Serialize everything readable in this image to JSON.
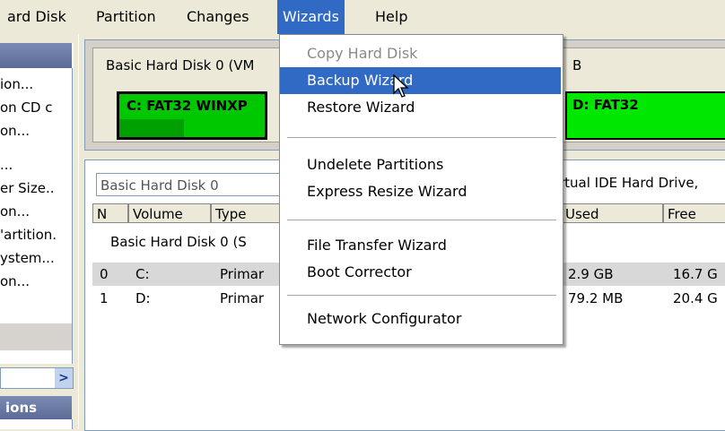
{
  "menubar": {
    "items": [
      "ard Disk",
      "Partition",
      "Changes",
      "Wizards",
      "Help"
    ],
    "active": "Wizards"
  },
  "left_pane": {
    "items": [
      "ion...",
      "on CD c",
      "on...",
      "...",
      "er Size..",
      "on...",
      "'artition.",
      "ystem...",
      "on..."
    ],
    "section": "ions",
    "scroll_arrow": ">"
  },
  "disk_map": {
    "label": "Basic Hard Disk 0 (VM",
    "label_b": "B",
    "partition_c": "C: FAT32 WINXP",
    "partition_d": "D: FAT32"
  },
  "table": {
    "title": "Basic Hard Disk 0",
    "title_right": "rtual IDE Hard Drive,",
    "columns": [
      "N",
      "Volume",
      "Type",
      "Used",
      "Free"
    ],
    "group": "Basic Hard Disk 0 (S",
    "rows": [
      {
        "n": "0",
        "volume": "C:",
        "type": "Primar",
        "used": "2.9 GB",
        "free": "16.7 G"
      },
      {
        "n": "1",
        "volume": "D:",
        "type": "Primar",
        "used": "79.2 MB",
        "free": "20.4 G"
      }
    ]
  },
  "wizards_menu": {
    "copy_hard_disk": "Copy Hard Disk",
    "backup_wizard": "Backup Wizard",
    "restore_wizard": "Restore Wizard",
    "undelete_partitions": "Undelete Partitions",
    "express_resize_wizard": "Express Resize Wizard",
    "file_transfer_wizard": "File Transfer Wizard",
    "boot_corrector": "Boot Corrector",
    "network_configurator": "Network Configurator"
  },
  "colors": {
    "menu_highlight": "#316ac5",
    "partition_c": "#00c800",
    "partition_d": "#00e800",
    "pane_header": "#5b6b96"
  }
}
